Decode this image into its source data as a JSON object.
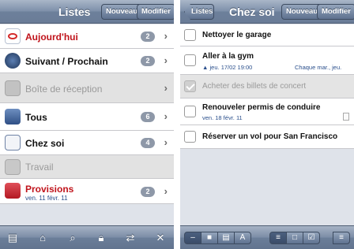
{
  "left": {
    "title": "Listes",
    "btn_new": "Nouveau",
    "btn_edit": "Modifier",
    "items": [
      {
        "label": "Aujourd'hui",
        "badge": "2",
        "icon": "today-icon"
      },
      {
        "label": "Suivant / Prochain",
        "badge": "2",
        "icon": "clock-icon"
      },
      {
        "label": "Boîte de réception",
        "badge": "",
        "icon": "inbox-icon"
      },
      {
        "label": "Tous",
        "badge": "6",
        "icon": "all-icon"
      },
      {
        "label": "Chez soi",
        "badge": "4",
        "icon": "notepad-icon"
      },
      {
        "label": "Travail",
        "badge": "",
        "icon": "lock-icon"
      },
      {
        "label": "Provisions",
        "sub": "ven. 11 févr. 11",
        "badge": "2",
        "icon": "provisions-icon"
      }
    ]
  },
  "right": {
    "back": "Listes",
    "title": "Chez soi",
    "btn_new": "Nouveau",
    "btn_edit": "Modifier",
    "tasks": [
      {
        "label": "Nettoyer le garage",
        "done": false
      },
      {
        "label": "Aller à la gym",
        "sub": "jeu. 17/02 19:00",
        "repeat": "Chaque mar., jeu.",
        "done": false
      },
      {
        "label": "Acheter des billets de concert",
        "done": true
      },
      {
        "label": "Renouveler permis de conduire",
        "sub": "ven. 18 févr. 11",
        "done": false
      },
      {
        "label": "Réserver un vol pour San Francisco",
        "done": false
      }
    ]
  }
}
